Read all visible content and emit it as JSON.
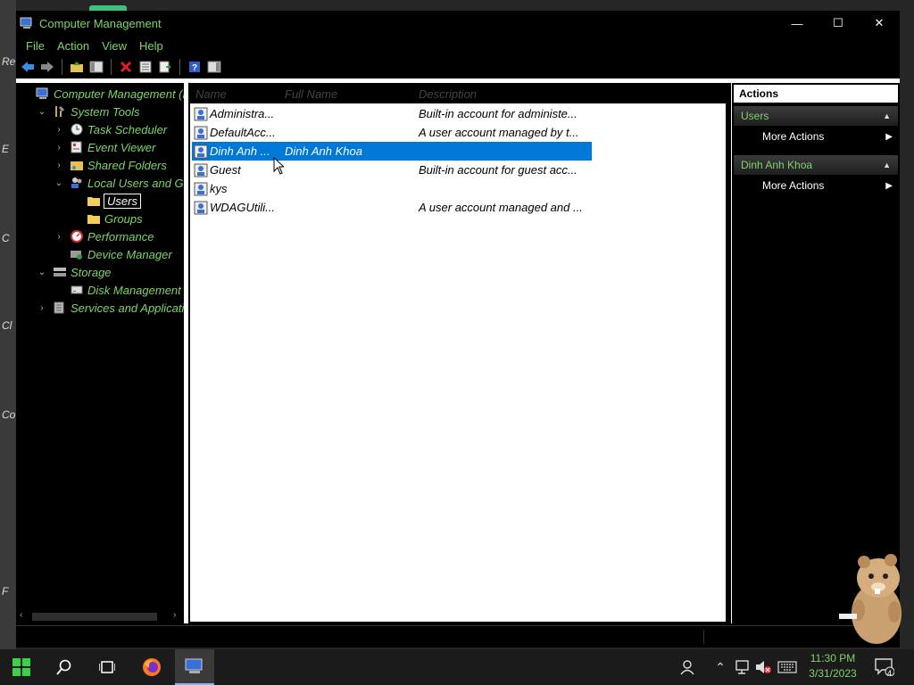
{
  "desktop": {
    "side_labels": [
      "Re",
      "E",
      "C",
      "Cl",
      "Co",
      "F"
    ]
  },
  "window": {
    "title": "Computer Management",
    "controls": {
      "minimize": "—",
      "maximize": "☐",
      "close": "✕"
    }
  },
  "menu": [
    "File",
    "Action",
    "View",
    "Help"
  ],
  "tree": {
    "items": [
      {
        "label": "Computer Management (Lo",
        "level": 0,
        "chevron": "",
        "icon": "computer-management-icon"
      },
      {
        "label": "System Tools",
        "level": 1,
        "chevron": "⌄",
        "icon": "system-tools-icon"
      },
      {
        "label": "Task Scheduler",
        "level": 2,
        "chevron": "›",
        "icon": "clock-icon"
      },
      {
        "label": "Event Viewer",
        "level": 2,
        "chevron": "›",
        "icon": "event-viewer-icon"
      },
      {
        "label": "Shared Folders",
        "level": 2,
        "chevron": "›",
        "icon": "shared-folder-icon"
      },
      {
        "label": "Local Users and Grou",
        "level": 2,
        "chevron": "⌄",
        "icon": "users-icon"
      },
      {
        "label": "Users",
        "level": 3,
        "chevron": "",
        "icon": "folder-icon",
        "selected": true
      },
      {
        "label": "Groups",
        "level": 3,
        "chevron": "",
        "icon": "folder-icon"
      },
      {
        "label": "Performance",
        "level": 2,
        "chevron": "›",
        "icon": "performance-icon"
      },
      {
        "label": "Device Manager",
        "level": 2,
        "chevron": "",
        "icon": "device-manager-icon"
      },
      {
        "label": "Storage",
        "level": 1,
        "chevron": "⌄",
        "icon": "storage-icon"
      },
      {
        "label": "Disk Management",
        "level": 2,
        "chevron": "",
        "icon": "disk-icon"
      },
      {
        "label": "Services and Applicatior",
        "level": 1,
        "chevron": "›",
        "icon": "services-icon"
      }
    ]
  },
  "list": {
    "columns": [
      "Name",
      "Full Name",
      "Description"
    ],
    "rows": [
      {
        "name": "Administra...",
        "full_name": "",
        "description": "Built-in account for administe..."
      },
      {
        "name": "DefaultAcc...",
        "full_name": "",
        "description": "A user account managed by t..."
      },
      {
        "name": "Dinh Anh ...",
        "full_name": "Dinh Anh Khoa",
        "description": "",
        "selected": true
      },
      {
        "name": "Guest",
        "full_name": "",
        "description": "Built-in account for guest acc..."
      },
      {
        "name": "kys",
        "full_name": "",
        "description": ""
      },
      {
        "name": "WDAGUtili...",
        "full_name": "",
        "description": "A user account managed and ..."
      }
    ]
  },
  "actions": {
    "title": "Actions",
    "sections": [
      {
        "header": "Users",
        "items": [
          "More Actions"
        ]
      },
      {
        "header": "Dinh Anh Khoa",
        "items": [
          "More Actions"
        ]
      }
    ]
  },
  "taskbar": {
    "time": "11:30 PM",
    "date": "3/31/2023",
    "notification_count": "4"
  },
  "colors": {
    "accent_text": "#7fd46a",
    "selection": "#0078d7",
    "background": "#000000"
  }
}
